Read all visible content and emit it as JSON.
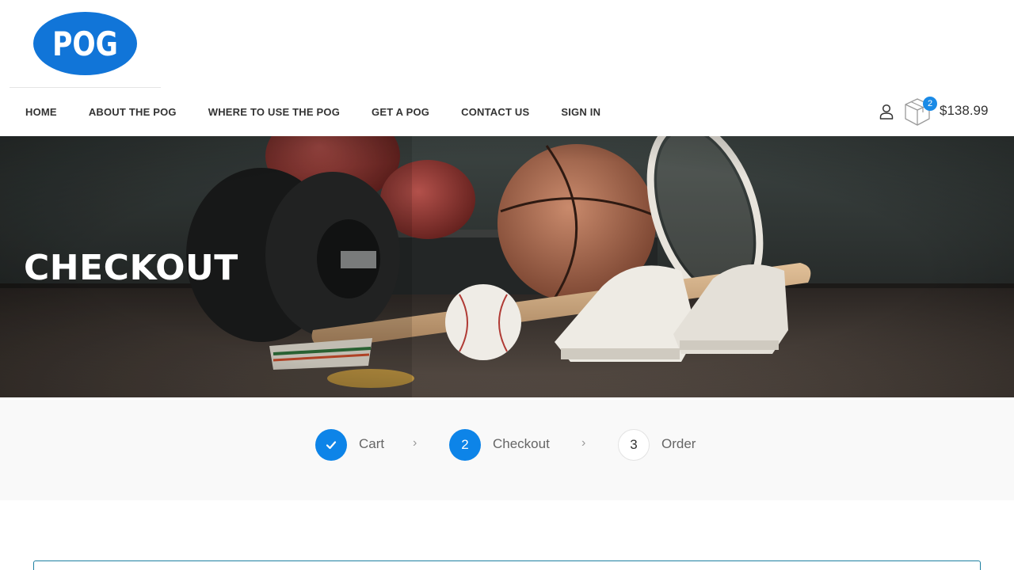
{
  "brand": {
    "logo_text": "POG",
    "logo_color": "#1175d8"
  },
  "nav": {
    "items": [
      {
        "label": "HOME"
      },
      {
        "label": "ABOUT THE POG"
      },
      {
        "label": "WHERE TO USE THE POG"
      },
      {
        "label": "GET A POG"
      },
      {
        "label": "CONTACT US"
      },
      {
        "label": "SIGN IN"
      }
    ]
  },
  "cart": {
    "count": "2",
    "total": "$138.99",
    "badge_color": "#1a8ae6"
  },
  "hero": {
    "title": "CHECKOUT"
  },
  "steps": {
    "accent_color": "#0d84e8",
    "items": [
      {
        "marker": "✓",
        "label": "Cart",
        "state": "done"
      },
      {
        "marker": "2",
        "label": "Checkout",
        "state": "active"
      },
      {
        "marker": "3",
        "label": "Order",
        "state": "pending"
      }
    ],
    "separator": "›"
  }
}
